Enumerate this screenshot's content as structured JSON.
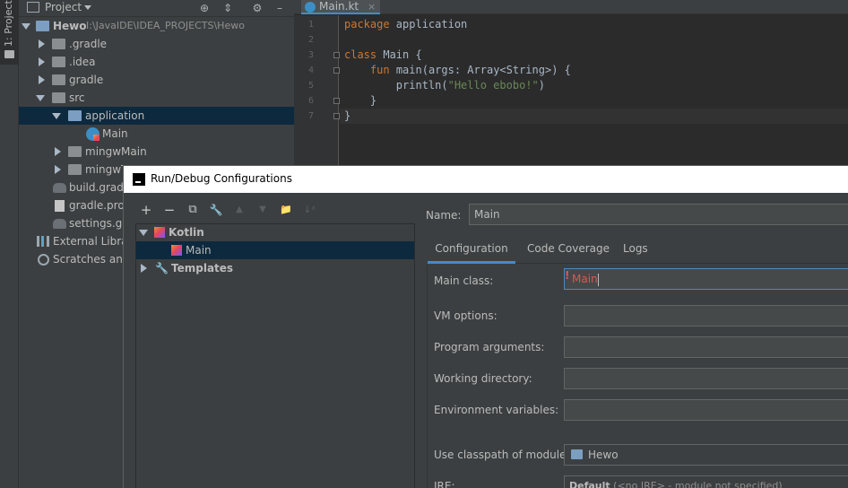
{
  "tool_strip": {
    "project_tab_label": "1: Project"
  },
  "project_panel": {
    "title": "Project",
    "tree": [
      {
        "label": "Hewo",
        "sub": "I:\\JavaIDE\\IDEA_PROJECTS\\Hewo"
      },
      {
        "label": ".gradle"
      },
      {
        "label": ".idea"
      },
      {
        "label": "gradle"
      },
      {
        "label": "src"
      },
      {
        "label": "application"
      },
      {
        "label": "Main"
      },
      {
        "label": "mingwMain"
      },
      {
        "label": "mingwT"
      },
      {
        "label": "build.gradle"
      },
      {
        "label": "gradle.prop"
      },
      {
        "label": "settings.gra"
      },
      {
        "label": "External Librari"
      },
      {
        "label": "Scratches and C"
      }
    ]
  },
  "editor": {
    "tab_label": "Main.kt",
    "tab_close": "×",
    "line_numbers": [
      "1",
      "2",
      "3",
      "4",
      "5",
      "6",
      "7"
    ],
    "code": {
      "l1_kw": "package",
      "l1_rest": " application",
      "l3_kw": "class",
      "l3_rest": " Main {",
      "l4_indent": "    ",
      "l4_kw": "fun",
      "l4_rest": " main(args: Array<String>) {",
      "l5_a": "        println(",
      "l5_str": "\"Hello ebobo!\"",
      "l5_b": ")",
      "l6": "    }",
      "l7": "}"
    }
  },
  "dialog": {
    "title": "Run/Debug Configurations",
    "toolbar": {
      "add": "+",
      "remove": "−",
      "copy": "⧉",
      "edit": "🔧",
      "up": "▲",
      "down": "▼",
      "folder": "📁",
      "sort": "↓ᵃ"
    },
    "tree": {
      "kotlin": "Kotlin",
      "main": "Main",
      "templates": "Templates"
    },
    "name_label": "Name:",
    "name_value": "Main",
    "tabs": [
      "Configuration",
      "Code Coverage",
      "Logs"
    ],
    "fields": {
      "main_class_label": "Main class:",
      "main_class_value": "Main",
      "vm_options_label": "VM options:",
      "program_args_label": "Program arguments:",
      "working_dir_label": "Working directory:",
      "env_vars_label": "Environment variables:",
      "classpath_label": "Use classpath of module:",
      "classpath_value": "Hewo",
      "jre_label": "JRE:",
      "jre_value_bold": "Default",
      "jre_value_rest": " (<no JRE> - module not specified)"
    },
    "error_icon": "!"
  }
}
